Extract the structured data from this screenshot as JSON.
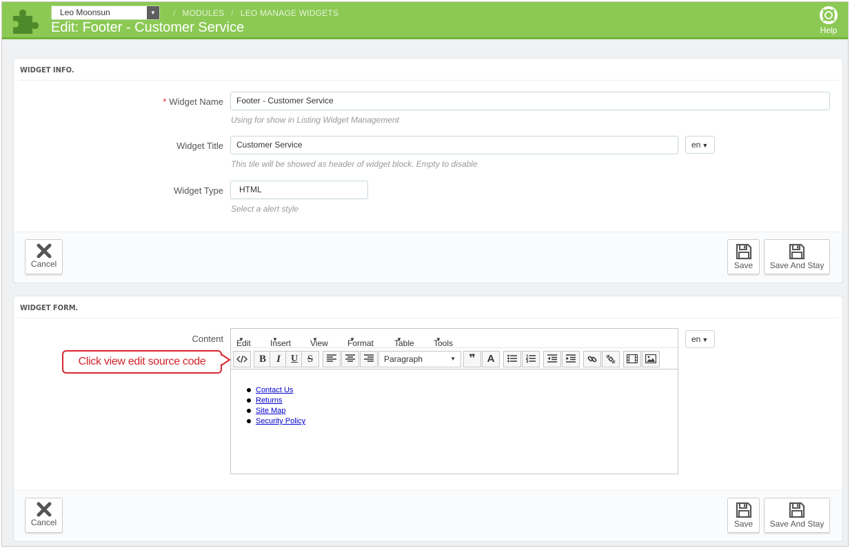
{
  "header": {
    "shop_select": "Leo Moonsun",
    "breadcrumb": [
      "MODULES",
      "LEO MANAGE WIDGETS"
    ],
    "breadcrumb_sep": "/",
    "page_title": "Edit: Footer - Customer Service",
    "help_label": "Help",
    "colors": {
      "bar": "#8bc954",
      "bar_border": "#72b33b"
    }
  },
  "widget_info": {
    "heading": "WIDGET INFO.",
    "required_mark": "*",
    "name_label": "Widget Name",
    "name_value": "Footer - Customer Service",
    "name_hint": "Using for show in Listing Widget Management",
    "title_label": "Widget Title",
    "title_value": "Customer Service",
    "title_hint": "This tile will be showed as header of widget block. Empty to disable",
    "lang": "en",
    "type_label": "Widget Type",
    "type_value": "HTML",
    "type_hint": "Select a alert style"
  },
  "actions": {
    "cancel": "Cancel",
    "save": "Save",
    "save_and_stay": "Save And Stay"
  },
  "widget_form": {
    "heading": "WIDGET FORM.",
    "content_label": "Content",
    "lang": "en",
    "menus": [
      "Edit",
      "Insert",
      "View",
      "Format",
      "Table",
      "Tools"
    ],
    "format_select": "Paragraph",
    "list_items": [
      "Contact Us",
      "Returns",
      "Site Map",
      "Security Policy"
    ]
  },
  "callout": {
    "text": "Click view edit source code",
    "color": "#d8262d"
  }
}
